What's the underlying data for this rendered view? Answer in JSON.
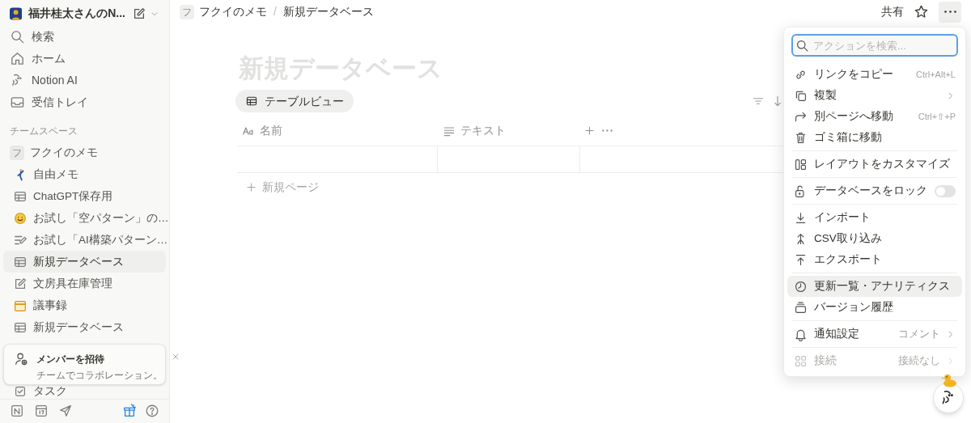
{
  "workspace": {
    "name": "福井桂太さんのN..."
  },
  "sidebar": {
    "nav": [
      {
        "label": "検索"
      },
      {
        "label": "ホーム"
      },
      {
        "label": "Notion AI"
      },
      {
        "label": "受信トレイ"
      }
    ],
    "section_title": "チームスペース",
    "teamspace": {
      "badge": "フ",
      "label": "フクイのメモ",
      "selected": false,
      "children": [
        {
          "label": "自由メモ",
          "selected": false
        },
        {
          "label": "ChatGPT保存用",
          "selected": false
        },
        {
          "label": "お試し「空パターン」の…",
          "selected": false
        },
        {
          "label": "お試し「AI構築パターン…",
          "selected": false
        },
        {
          "label": "新規データベース",
          "selected": true
        },
        {
          "label": "文房具在庫管理",
          "selected": false
        },
        {
          "label": "議事録",
          "selected": false
        },
        {
          "label": "新規データベース",
          "selected": false
        },
        {
          "label": "タスク",
          "selected": false
        }
      ]
    },
    "invite": {
      "title": "メンバーを招待",
      "subtitle": "チームでコラボレーション。"
    }
  },
  "topbar": {
    "breadcrumb": [
      {
        "badge": "フ",
        "label": "フクイのメモ"
      },
      {
        "label": "新規データベース"
      }
    ],
    "separator": "/",
    "share": "共有"
  },
  "page": {
    "title": "新規データベース",
    "views": [
      {
        "label": "テーブルビュー",
        "selected": true
      }
    ],
    "table": {
      "columns": [
        {
          "label": "名前"
        },
        {
          "label": "テキスト"
        }
      ],
      "new_row": "新規ページ"
    }
  },
  "menu": {
    "search_placeholder": "アクションを検索...",
    "sections": [
      [
        {
          "kind": "action",
          "label": "リンクをコピー",
          "shortcut": "Ctrl+Alt+L",
          "submenu": false,
          "highlighted": false,
          "disabled": false
        },
        {
          "kind": "action",
          "label": "複製",
          "submenu": true,
          "highlighted": false,
          "disabled": false
        },
        {
          "kind": "action",
          "label": "別ページへ移動",
          "shortcut": "Ctrl+⇧+P",
          "submenu": false,
          "highlighted": false,
          "disabled": false
        },
        {
          "kind": "action",
          "label": "ゴミ箱に移動",
          "submenu": false,
          "highlighted": false,
          "disabled": false
        }
      ],
      [
        {
          "kind": "action",
          "label": "レイアウトをカスタマイズ",
          "submenu": false,
          "highlighted": false,
          "disabled": false
        }
      ],
      [
        {
          "kind": "toggle",
          "label": "データベースをロック",
          "on": false,
          "highlighted": false,
          "disabled": false
        }
      ],
      [
        {
          "kind": "action",
          "label": "インポート",
          "submenu": false,
          "highlighted": false,
          "disabled": false
        },
        {
          "kind": "action",
          "label": "CSV取り込み",
          "submenu": false,
          "highlighted": false,
          "disabled": false
        },
        {
          "kind": "action",
          "label": "エクスポート",
          "submenu": false,
          "highlighted": false,
          "disabled": false
        }
      ],
      [
        {
          "kind": "action",
          "label": "更新一覧・アナリティクス",
          "submenu": false,
          "highlighted": true,
          "disabled": false
        },
        {
          "kind": "action",
          "label": "バージョン履歴",
          "submenu": false,
          "highlighted": false,
          "disabled": false
        }
      ],
      [
        {
          "kind": "action",
          "label": "通知設定",
          "value": "コメント",
          "submenu": true,
          "highlighted": false,
          "disabled": false
        }
      ],
      [
        {
          "kind": "action",
          "label": "接続",
          "value": "接続なし",
          "submenu": true,
          "highlighted": false,
          "disabled": true
        }
      ]
    ]
  }
}
